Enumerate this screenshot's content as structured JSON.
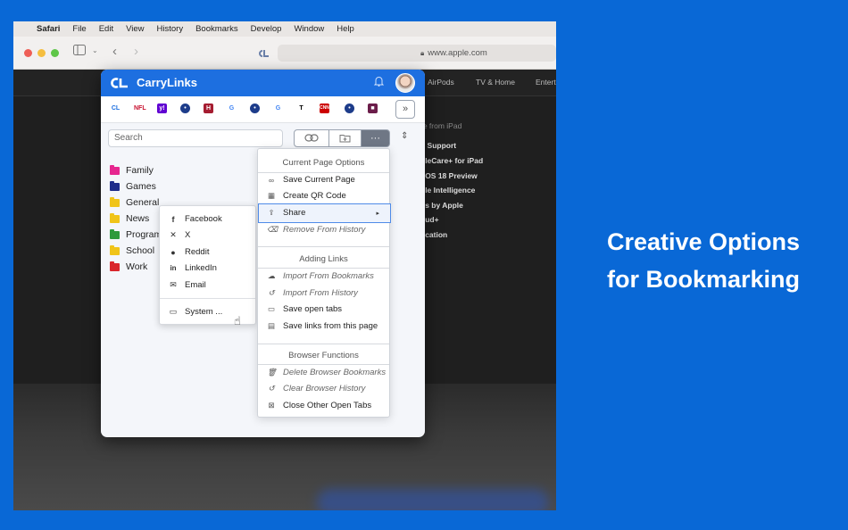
{
  "menubar": {
    "app": "Safari",
    "items": [
      "File",
      "Edit",
      "View",
      "History",
      "Bookmarks",
      "Develop",
      "Window",
      "Help"
    ]
  },
  "browser": {
    "url": "www.apple.com"
  },
  "website": {
    "nav": [
      "AirPods",
      "TV & Home",
      "Entert"
    ],
    "menu_heading": "re from iPad",
    "menu_items": [
      "d Support",
      "pleCare+ for iPad",
      "dOS 18 Preview",
      "ple Intelligence",
      "ps by Apple",
      "oud+",
      "ucation"
    ]
  },
  "popup": {
    "title": "CarryLinks",
    "favicons": [
      {
        "label": "CL",
        "color": "#1d6fe0",
        "bg": "#ffffff"
      },
      {
        "label": "NFL",
        "color": "#c8102e",
        "bg": "#ffffff"
      },
      {
        "label": "y!",
        "color": "#ffffff",
        "bg": "#6001d2"
      },
      {
        "label": "•",
        "color": "#ffffff",
        "bg": "#1d3c8a"
      },
      {
        "label": "H",
        "color": "#ffffff",
        "bg": "#a51c30"
      },
      {
        "label": "G",
        "color": "#4285f4",
        "bg": "#ffffff"
      },
      {
        "label": "•",
        "color": "#ffffff",
        "bg": "#1d3c8a"
      },
      {
        "label": "G",
        "color": "#4285f4",
        "bg": "#ffffff"
      },
      {
        "label": "T",
        "color": "#000000",
        "bg": "#ffffff"
      },
      {
        "label": "CNN",
        "color": "#ffffff",
        "bg": "#cc0000"
      },
      {
        "label": "•",
        "color": "#ffffff",
        "bg": "#1d3c8a"
      },
      {
        "label": "■",
        "color": "#ffffff",
        "bg": "#6b1d4a"
      }
    ],
    "search_placeholder": "Search",
    "folders": [
      {
        "name": "Family",
        "color": "#e6268f"
      },
      {
        "name": "Games",
        "color": "#1f2d8a"
      },
      {
        "name": "General",
        "color": "#f0c419"
      },
      {
        "name": "News",
        "color": "#f0c419"
      },
      {
        "name": "Program",
        "color": "#2e9a3c"
      },
      {
        "name": "School",
        "color": "#f0c419"
      },
      {
        "name": "Work",
        "color": "#d9262b"
      }
    ],
    "share_menu": [
      "Facebook",
      "X",
      "Reddit",
      "LinkedIn",
      "Email"
    ],
    "share_system": "System ...",
    "options": {
      "current_page_header": "Current Page Options",
      "current_page": [
        "Save Current Page",
        "Create QR Code",
        "Share",
        "Remove From History"
      ],
      "adding_links_header": "Adding Links",
      "adding_links": [
        "Import From Bookmarks",
        "Import From History",
        "Save open tabs",
        "Save links from this page"
      ],
      "browser_functions_header": "Browser Functions",
      "browser_functions": [
        "Delete Browser Bookmarks",
        "Clear Browser History",
        "Close Other Open Tabs"
      ]
    }
  },
  "headline": {
    "line1": "Creative Options",
    "line2": "for Bookmarking"
  }
}
